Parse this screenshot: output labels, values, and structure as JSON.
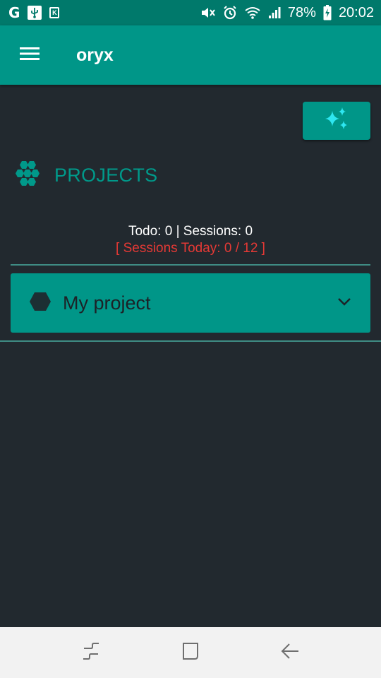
{
  "status_bar": {
    "left_glyph": "G",
    "notif_label": "K",
    "battery": "78%",
    "time": "20:02"
  },
  "app_bar": {
    "title": "oryx"
  },
  "projects": {
    "title": "PROJECTS",
    "stats": "Todo: 0 | Sessions: 0",
    "sessions_today": "[ Sessions Today: 0 / 12 ]",
    "items": [
      {
        "name": "My project"
      }
    ]
  },
  "colors": {
    "primary": "#009688",
    "primary_dark": "#00796b",
    "background": "#22292f",
    "accent": "#2ee6f0",
    "warning": "#e53935"
  }
}
